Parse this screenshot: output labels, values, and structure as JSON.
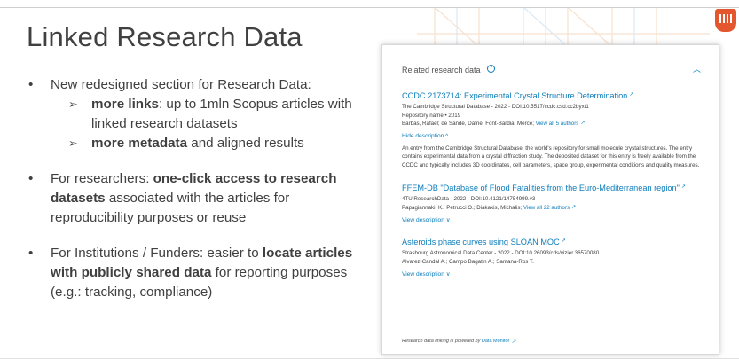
{
  "slide": {
    "title": "Linked Research Data",
    "bullets": [
      {
        "text": "New redesigned section for Research Data:"
      },
      {
        "text": "For researchers: ",
        "bold": "one-click access to research datasets",
        "text2": " associated with the articles for reproducibility purposes or reuse"
      },
      {
        "text": "For Institutions / Funders:  easier to ",
        "bold": "locate articles with publicly shared data",
        "text2": " for reporting purposes (e.g.: tracking, compliance)"
      }
    ],
    "sub_bullets": [
      {
        "bold": "more links",
        "text": ": up to 1mln Scopus articles with linked research datasets"
      },
      {
        "bold": "more metadata",
        "text": " and aligned results"
      }
    ]
  },
  "panel": {
    "title": "Related research data",
    "entries": [
      {
        "title": "CCDC 2173714: Experimental Crystal Structure Determination",
        "line1": "The Cambridge Structural Database - 2022 - DOI:10.5517/ccdc.csd.cc2byxt1",
        "line2": "Repository name • 2019",
        "authors": "Barbas, Rafael; de Sande, Dafne; Font-Bardia, Mercè;",
        "authors_link": "View all 5 authors",
        "toggle": "Hide description ^",
        "description": "An entry from the Cambridge Structural Database, the world's repository for small molecule crystal structures. The entry contains experimental data from a crystal diffraction study. The deposited dataset for this entry is freely available from the CCDC and typically includes 3D coordinates, cell parameters, space group, experimental conditions and quality measures."
      },
      {
        "title": "FFEM-DB \"Database of Flood Fatalities from the Euro-Mediterranean region\"",
        "line1": "4TU.ResearchData - 2022 - DOI:10.4121/14754999.v3",
        "authors": "Papagiannaki, K.; Petrucci O.; Diakakis, Michalis;",
        "authors_link": "View all 22 authors",
        "toggle": "View description ∨"
      },
      {
        "title": "Asteroids phase curves using SLOAN MOC",
        "line1": "Strasbourg Astronomical Data Center - 2022 - DOI:10.26093/cds/vizier.36570080",
        "authors": "Alvarez-Candal A.; Campo Bagatin A.; Santana-Ros T.",
        "toggle": "View description ∨"
      }
    ],
    "footer_text": "Research data linking is powered by",
    "footer_link": "Data Monitor"
  },
  "colors": {
    "link": "#0c7dbb",
    "text": "#404040",
    "badge": "#e4572e"
  },
  "icons": {
    "help": "help-icon",
    "collapse": "chevron-up-icon",
    "external": "external-link-icon",
    "badge": "hand-logo-icon"
  }
}
